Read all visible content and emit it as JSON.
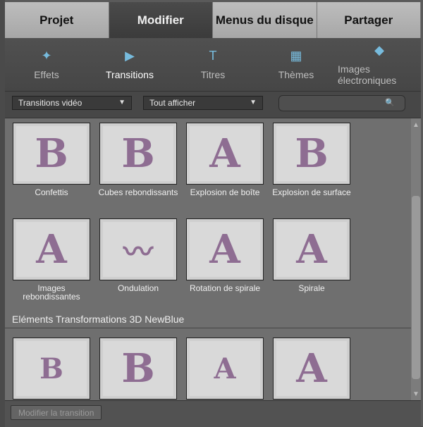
{
  "tabs": [
    "Projet",
    "Modifier",
    "Menus du disque",
    "Partager"
  ],
  "toolbar": [
    {
      "label": "Effets",
      "icon": "fx-icon"
    },
    {
      "label": "Transitions",
      "icon": "transition-arrow-icon"
    },
    {
      "label": "Titres",
      "icon": "title-icon"
    },
    {
      "label": "Thèmes",
      "icon": "themes-icon"
    },
    {
      "label": "Images électroniques",
      "icon": "clip-art-icon"
    }
  ],
  "filters": {
    "category": "Transitions vidéo",
    "show": "Tout afficher"
  },
  "grid": {
    "row1": [
      "Confettis",
      "Cubes rebondissants",
      "Explosion de boîte",
      "Explosion de surface"
    ],
    "row2": [
      "Images rebondissantes",
      "Ondulation",
      "Rotation de spirale",
      "Spirale"
    ]
  },
  "section_title": "Eléments Transformations 3D NewBlue",
  "bottom_button": "Modifier la transition"
}
